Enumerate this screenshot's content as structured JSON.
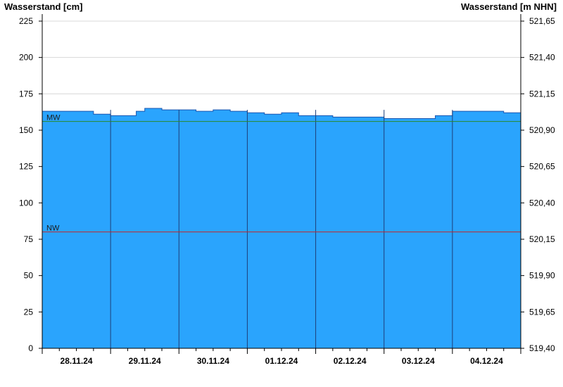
{
  "chart_data": {
    "type": "area",
    "left_axis_title": "Wasserstand [cm]",
    "right_axis_title": "Wasserstand [m NHN]",
    "ylim": [
      0,
      225
    ],
    "yticks": [
      "0",
      "25",
      "50",
      "75",
      "100",
      "125",
      "150",
      "175",
      "200",
      "225"
    ],
    "right_ylim": [
      519.4,
      521.65
    ],
    "right_yticks": [
      "519,40",
      "519,65",
      "519,90",
      "520,15",
      "520,40",
      "520,65",
      "520,90",
      "521,15",
      "521,40",
      "521,65"
    ],
    "xlim": [
      "2024-11-27T12:00",
      "2024-12-04T12:00"
    ],
    "date_labels": [
      "28.11.24",
      "29.11.24",
      "30.11.24",
      "01.12.24",
      "02.12.24",
      "03.12.24",
      "04.12.24"
    ],
    "series": [
      {
        "values": [
          {
            "x": "2024-11-27T12:00",
            "y": 163
          },
          {
            "x": "2024-11-28T00:00",
            "y": 163
          },
          {
            "x": "2024-11-28T06:00",
            "y": 161
          },
          {
            "x": "2024-11-28T12:00",
            "y": 160
          },
          {
            "x": "2024-11-28T18:00",
            "y": 160
          },
          {
            "x": "2024-11-28T21:00",
            "y": 163
          },
          {
            "x": "2024-11-29T00:00",
            "y": 165
          },
          {
            "x": "2024-11-29T06:00",
            "y": 164
          },
          {
            "x": "2024-11-29T12:00",
            "y": 164
          },
          {
            "x": "2024-11-29T18:00",
            "y": 163
          },
          {
            "x": "2024-11-30T00:00",
            "y": 164
          },
          {
            "x": "2024-11-30T06:00",
            "y": 163
          },
          {
            "x": "2024-11-30T12:00",
            "y": 162
          },
          {
            "x": "2024-11-30T18:00",
            "y": 161
          },
          {
            "x": "2024-12-01T00:00",
            "y": 162
          },
          {
            "x": "2024-12-01T06:00",
            "y": 160
          },
          {
            "x": "2024-12-01T12:00",
            "y": 160
          },
          {
            "x": "2024-12-01T18:00",
            "y": 159
          },
          {
            "x": "2024-12-02T00:00",
            "y": 159
          },
          {
            "x": "2024-12-02T06:00",
            "y": 159
          },
          {
            "x": "2024-12-02T12:00",
            "y": 158
          },
          {
            "x": "2024-12-02T18:00",
            "y": 158
          },
          {
            "x": "2024-12-03T00:00",
            "y": 158
          },
          {
            "x": "2024-12-03T06:00",
            "y": 160
          },
          {
            "x": "2024-12-03T12:00",
            "y": 163
          },
          {
            "x": "2024-12-03T18:00",
            "y": 163
          },
          {
            "x": "2024-12-04T00:00",
            "y": 163
          },
          {
            "x": "2024-12-04T06:00",
            "y": 162
          },
          {
            "x": "2024-12-04T12:00",
            "y": 162
          }
        ],
        "color": "#2aa4fd"
      }
    ],
    "reference_lines": [
      {
        "label": "MW",
        "y": 156,
        "color": "#2a8a2a"
      },
      {
        "label": "NW",
        "y": 80,
        "color": "#c02828"
      }
    ],
    "grid": true
  }
}
